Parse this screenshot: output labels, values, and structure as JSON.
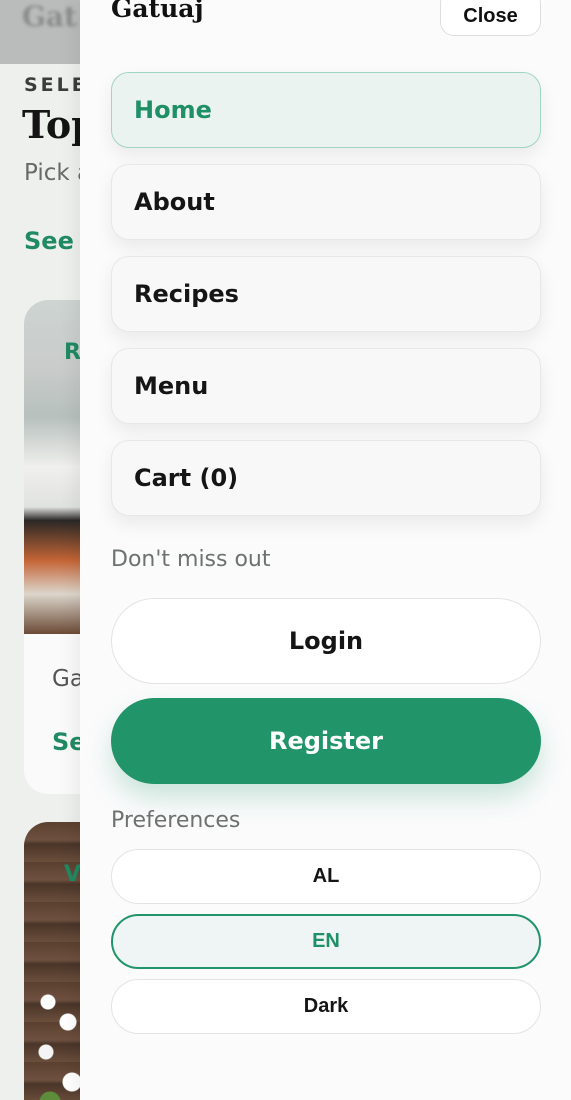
{
  "background": {
    "logo": "Gat",
    "eyebrow": "SELEC",
    "title": "Top",
    "subtitle": "Pick a",
    "see_more": "See r",
    "card1": {
      "tag": "R",
      "name": "Ga",
      "link": "Se"
    },
    "card2": {
      "tag": "V"
    }
  },
  "drawer": {
    "brand": "Gatuaj",
    "close_label": "Close",
    "nav": [
      {
        "label": "Home",
        "active": true
      },
      {
        "label": "About"
      },
      {
        "label": "Recipes"
      },
      {
        "label": "Menu"
      },
      {
        "label": "Cart (0)"
      }
    ],
    "promo_label": "Don't miss out",
    "login_label": "Login",
    "register_label": "Register",
    "preferences_label": "Preferences",
    "preferences": [
      {
        "label": "AL"
      },
      {
        "label": "EN",
        "active": true
      },
      {
        "label": "Dark"
      }
    ]
  },
  "colors": {
    "accent": "#229469",
    "active_bg": "#ebf3f0"
  }
}
